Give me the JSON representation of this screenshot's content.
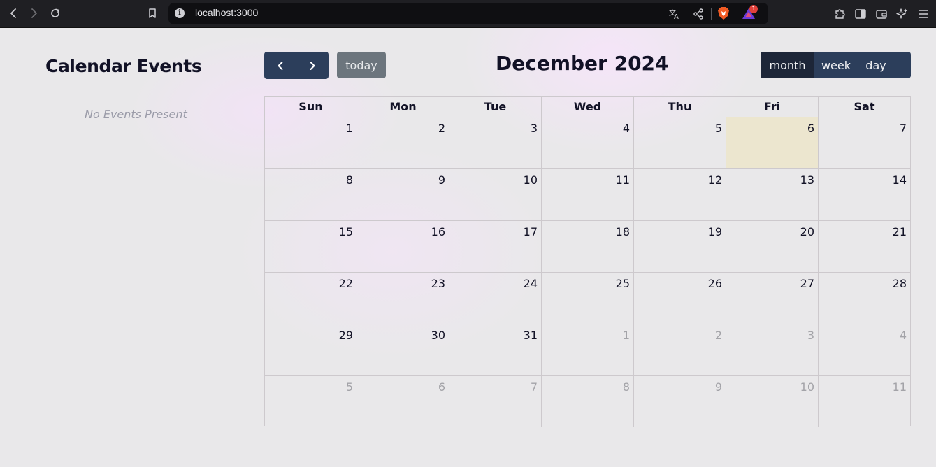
{
  "browser": {
    "url": "localhost:3000",
    "icons": [
      "back-icon",
      "forward-icon",
      "reload-icon",
      "bookmark-icon",
      "info-icon",
      "translate-icon",
      "share-icon",
      "brave-shield-icon",
      "brave-rewards-icon",
      "extensions-icon",
      "sidebar-icon",
      "wallet-icon",
      "leo-ai-icon",
      "menu-icon"
    ],
    "rewards_badge": "1"
  },
  "sidebar": {
    "title": "Calendar Events",
    "empty_text": "No Events Present"
  },
  "toolbar": {
    "prev_icon": "chevron-left-icon",
    "next_icon": "chevron-right-icon",
    "today_label": "today",
    "title": "December 2024",
    "views": [
      {
        "label": "month",
        "active": true
      },
      {
        "label": "week",
        "active": false
      },
      {
        "label": "day",
        "active": false
      }
    ]
  },
  "calendar": {
    "weekdays": [
      "Sun",
      "Mon",
      "Tue",
      "Wed",
      "Thu",
      "Fri",
      "Sat"
    ],
    "weeks": [
      [
        {
          "d": "1"
        },
        {
          "d": "2"
        },
        {
          "d": "3"
        },
        {
          "d": "4"
        },
        {
          "d": "5"
        },
        {
          "d": "6",
          "today": true
        },
        {
          "d": "7"
        }
      ],
      [
        {
          "d": "8"
        },
        {
          "d": "9"
        },
        {
          "d": "10"
        },
        {
          "d": "11"
        },
        {
          "d": "12"
        },
        {
          "d": "13"
        },
        {
          "d": "14"
        }
      ],
      [
        {
          "d": "15"
        },
        {
          "d": "16"
        },
        {
          "d": "17"
        },
        {
          "d": "18"
        },
        {
          "d": "19"
        },
        {
          "d": "20"
        },
        {
          "d": "21"
        }
      ],
      [
        {
          "d": "22"
        },
        {
          "d": "23"
        },
        {
          "d": "24"
        },
        {
          "d": "25"
        },
        {
          "d": "26"
        },
        {
          "d": "27"
        },
        {
          "d": "28"
        }
      ],
      [
        {
          "d": "29"
        },
        {
          "d": "30"
        },
        {
          "d": "31"
        },
        {
          "d": "1",
          "other": true
        },
        {
          "d": "2",
          "other": true
        },
        {
          "d": "3",
          "other": true
        },
        {
          "d": "4",
          "other": true
        }
      ],
      [
        {
          "d": "5",
          "other": true
        },
        {
          "d": "6",
          "other": true
        },
        {
          "d": "7",
          "other": true
        },
        {
          "d": "8",
          "other": true
        },
        {
          "d": "9",
          "other": true
        },
        {
          "d": "10",
          "other": true
        },
        {
          "d": "11",
          "other": true
        }
      ]
    ]
  },
  "colors": {
    "button_primary": "#2c3e5b",
    "button_active": "#1d2638",
    "today_button": "#6c757d",
    "today_cell": "#ece6cf",
    "text_dark": "#121226"
  }
}
